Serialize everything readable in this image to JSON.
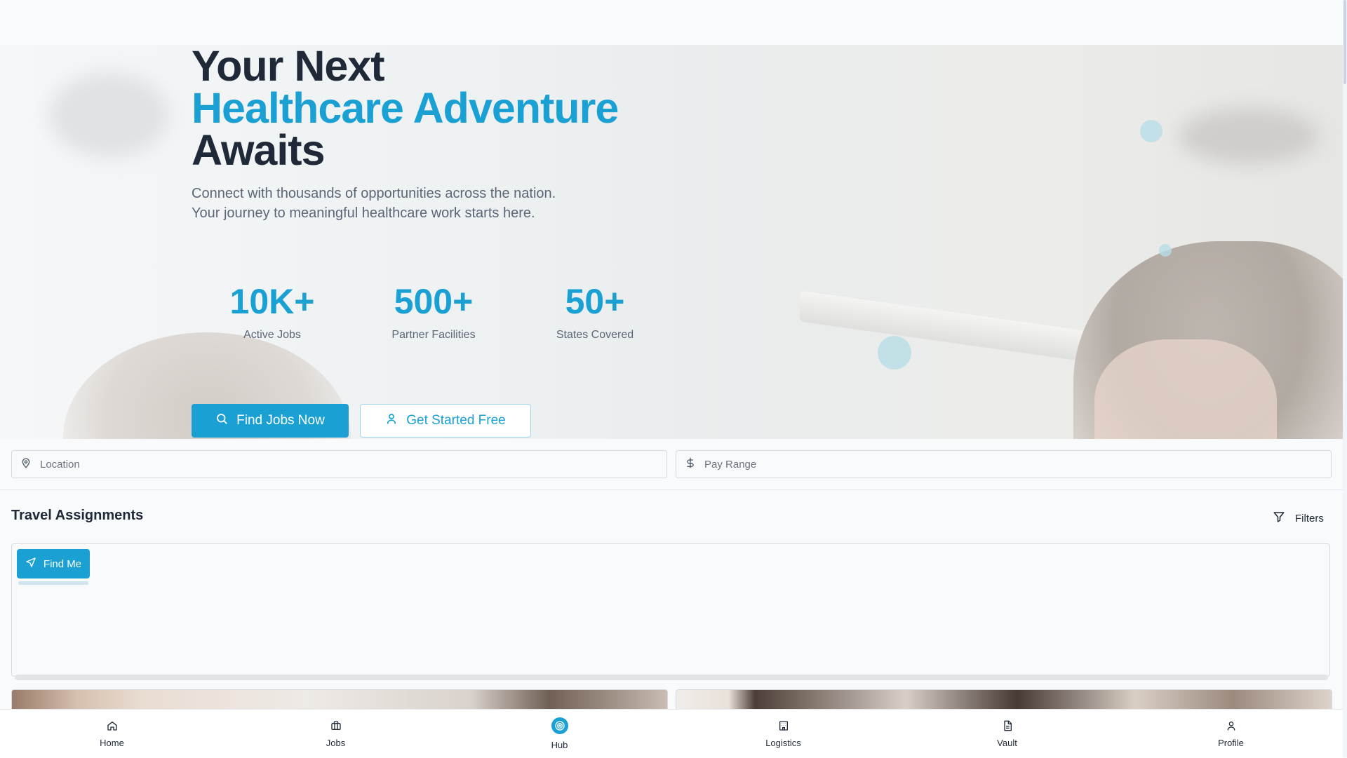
{
  "hero": {
    "title_line1": "Your Next",
    "title_line2": "Healthcare Adventure",
    "title_line3": "Awaits",
    "subtitle": "Connect with thousands of opportunities across the nation. Your journey to meaningful healthcare work starts here.",
    "stats": [
      {
        "value": "10K+",
        "label": "Active Jobs"
      },
      {
        "value": "500+",
        "label": "Partner Facilities"
      },
      {
        "value": "50+",
        "label": "States Covered"
      }
    ],
    "primary_cta": "Find Jobs Now",
    "secondary_cta": "Get Started Free"
  },
  "search": {
    "location_placeholder": "Location",
    "pay_placeholder": "Pay Range"
  },
  "section": {
    "title": "Travel Assignments",
    "filters_label": "Filters"
  },
  "map": {
    "find_me_label": "Find Me"
  },
  "nav": {
    "items": [
      {
        "label": "Home",
        "icon": "home-icon"
      },
      {
        "label": "Jobs",
        "icon": "briefcase-icon"
      },
      {
        "label": "Hub",
        "icon": "target-icon"
      },
      {
        "label": "Logistics",
        "icon": "building-icon"
      },
      {
        "label": "Vault",
        "icon": "document-icon"
      },
      {
        "label": "Profile",
        "icon": "user-icon"
      }
    ]
  },
  "colors": {
    "accent": "#1ba0d4",
    "text_dark": "#1f2937",
    "text_muted": "#5b6677"
  }
}
